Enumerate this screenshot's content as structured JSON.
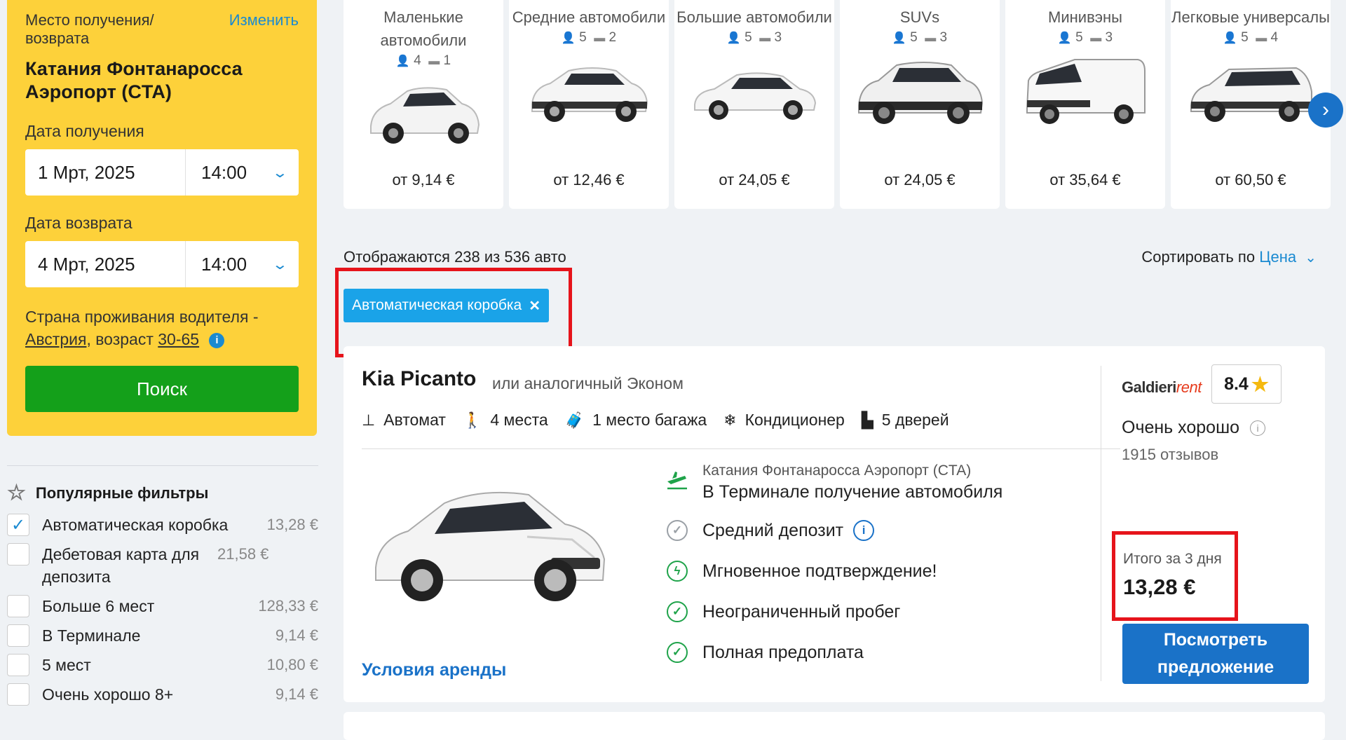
{
  "search": {
    "location_label": "Место получения/ возврата",
    "change_label": "Изменить",
    "location": "Катания Фонтанаросса Аэропорт (CTA)",
    "pickup_label": "Дата получения",
    "pickup_date": "1 Мрт, 2025",
    "pickup_time": "14:00",
    "return_label": "Дата возврата",
    "return_date": "4 Мрт, 2025",
    "return_time": "14:00",
    "country_prefix": "Страна проживания водителя -",
    "country": "Австрия",
    "age_prefix": ", возраст",
    "age": "30-65",
    "search_button": "Поиск"
  },
  "filters": {
    "title": "Популярные фильтры",
    "items": [
      {
        "label": "Автоматическая коробка",
        "price": "13,28 €",
        "checked": true
      },
      {
        "label": "Дебетовая карта для депозита",
        "price": "21,58 €",
        "checked": false
      },
      {
        "label": "Больше 6 мест",
        "price": "128,33 €",
        "checked": false
      },
      {
        "label": "В Терминале",
        "price": "9,14 €",
        "checked": false
      },
      {
        "label": "5 мест",
        "price": "10,80 €",
        "checked": false
      },
      {
        "label": "Очень хорошо 8+",
        "price": "9,14 €",
        "checked": false
      }
    ]
  },
  "categories": [
    {
      "name": "Маленькие автомобили",
      "seats": "4",
      "bags": "1",
      "price": "от 9,14 €"
    },
    {
      "name": "Средние автомобили",
      "seats": "5",
      "bags": "2",
      "price": "от 12,46 €"
    },
    {
      "name": "Большие автомобили",
      "seats": "5",
      "bags": "3",
      "price": "от 24,05 €"
    },
    {
      "name": "SUVs",
      "seats": "5",
      "bags": "3",
      "price": "от 24,05 €"
    },
    {
      "name": "Минивэны",
      "seats": "5",
      "bags": "3",
      "price": "от 35,64 €"
    },
    {
      "name": "Легковые универсалы",
      "seats": "5",
      "bags": "4",
      "price": "от 60,50 €"
    }
  ],
  "results": {
    "count_text": "Отображаются 238 из 536 авто",
    "sort_prefix": "Сортировать по",
    "sort_value": "Цена",
    "active_filter": "Автоматическая коробка"
  },
  "card": {
    "title": "Kia Picanto",
    "subtitle": "или аналогичный Эконом",
    "specs": [
      "Автомат",
      "4 места",
      "1 место багажа",
      "Кондиционер",
      "5 дверей"
    ],
    "pickup_location": "Катания Фонтанаросса Аэропорт (CTA)",
    "pickup_type": "В Терминале получение автомобиля",
    "features": [
      "Средний депозит",
      "Мгновенное подтверждение!",
      "Неограниченный пробег",
      "Полная предоплата"
    ],
    "terms": "Условия аренды",
    "supplier_main": "Galdieri",
    "supplier_rent": "rent",
    "score": "8.4",
    "rating_word": "Очень хорошо",
    "reviews": "1915 отзывов",
    "total_label": "Итого за 3 дня",
    "total_price": "13,28 €",
    "view_button": "Посмотреть предложение"
  },
  "colors": {
    "panel_yellow": "#fdd13a",
    "search_green": "#14a01a",
    "brand_blue": "#1a72c8",
    "chip_blue": "#1aa3e8",
    "highlight_red": "#e6141b"
  }
}
